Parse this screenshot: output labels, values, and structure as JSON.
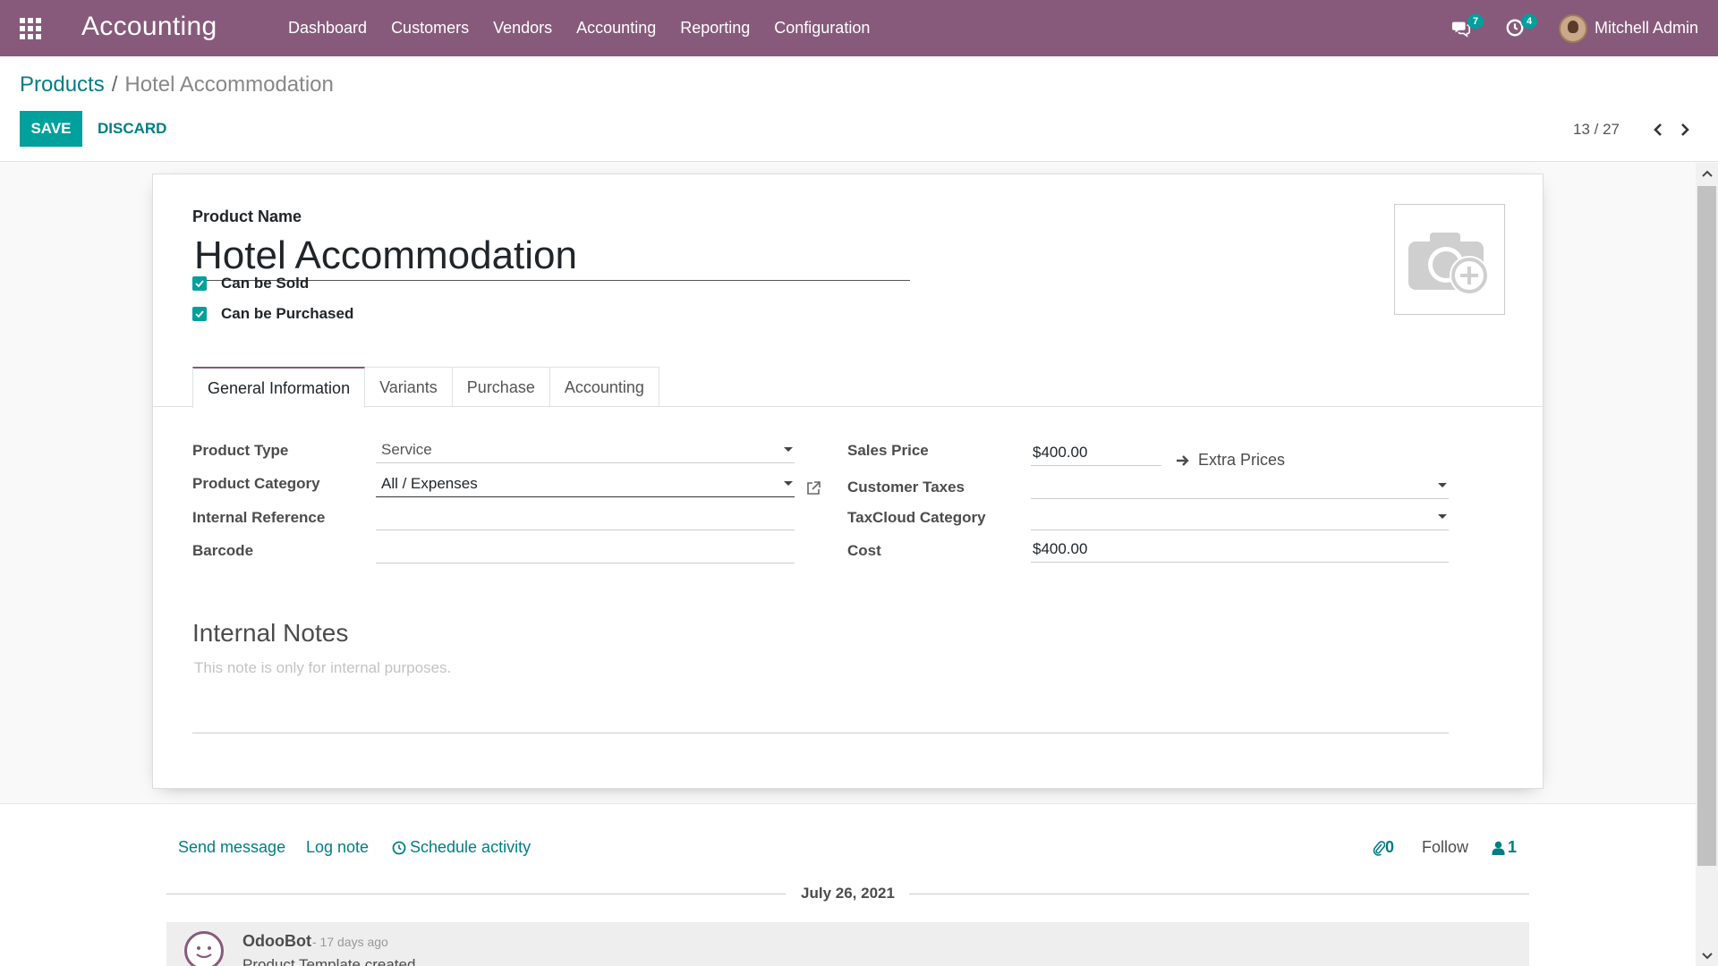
{
  "navbar": {
    "app_name": "Accounting",
    "menu": [
      "Dashboard",
      "Customers",
      "Vendors",
      "Accounting",
      "Reporting",
      "Configuration"
    ],
    "messages_count": "7",
    "activities_count": "4",
    "user_name": "Mitchell Admin",
    "color": "#875a7b"
  },
  "control_panel": {
    "breadcrumb_parent": "Products",
    "breadcrumb_separator": "/",
    "breadcrumb_current": "Hotel Accommodation",
    "save_label": "SAVE",
    "discard_label": "DISCARD",
    "pager": "13 / 27"
  },
  "form": {
    "product_name_label": "Product Name",
    "product_name": "Hotel Accommodation",
    "can_be_sold_label": "Can be Sold",
    "can_be_sold": true,
    "can_be_purchased_label": "Can be Purchased",
    "can_be_purchased": true,
    "tabs": [
      "General Information",
      "Variants",
      "Purchase",
      "Accounting"
    ],
    "active_tab": "General Information",
    "fields": {
      "product_type_label": "Product Type",
      "product_type": "Service",
      "product_category_label": "Product Category",
      "product_category": "All / Expenses",
      "internal_reference_label": "Internal Reference",
      "internal_reference": "",
      "barcode_label": "Barcode",
      "barcode": "",
      "sales_price_label": "Sales Price",
      "sales_price": "$400.00",
      "extra_prices_label": "Extra Prices",
      "customer_taxes_label": "Customer Taxes",
      "customer_taxes": "",
      "taxcloud_category_label": "TaxCloud Category",
      "taxcloud_category": "",
      "cost_label": "Cost",
      "cost": "$400.00"
    },
    "internal_notes_title": "Internal Notes",
    "internal_notes_placeholder": "This note is only for internal purposes."
  },
  "chatter": {
    "send_message": "Send message",
    "log_note": "Log note",
    "schedule_activity": "Schedule activity",
    "attachments_count": "0",
    "follow": "Follow",
    "followers_count": "1",
    "date_separator": "July 26, 2021",
    "message": {
      "author": "OdooBot",
      "date": "- 17 days ago",
      "body": "Product Template created"
    }
  },
  "colors": {
    "primary": "#00a09d",
    "link": "#017e84",
    "brand": "#875a7b"
  }
}
